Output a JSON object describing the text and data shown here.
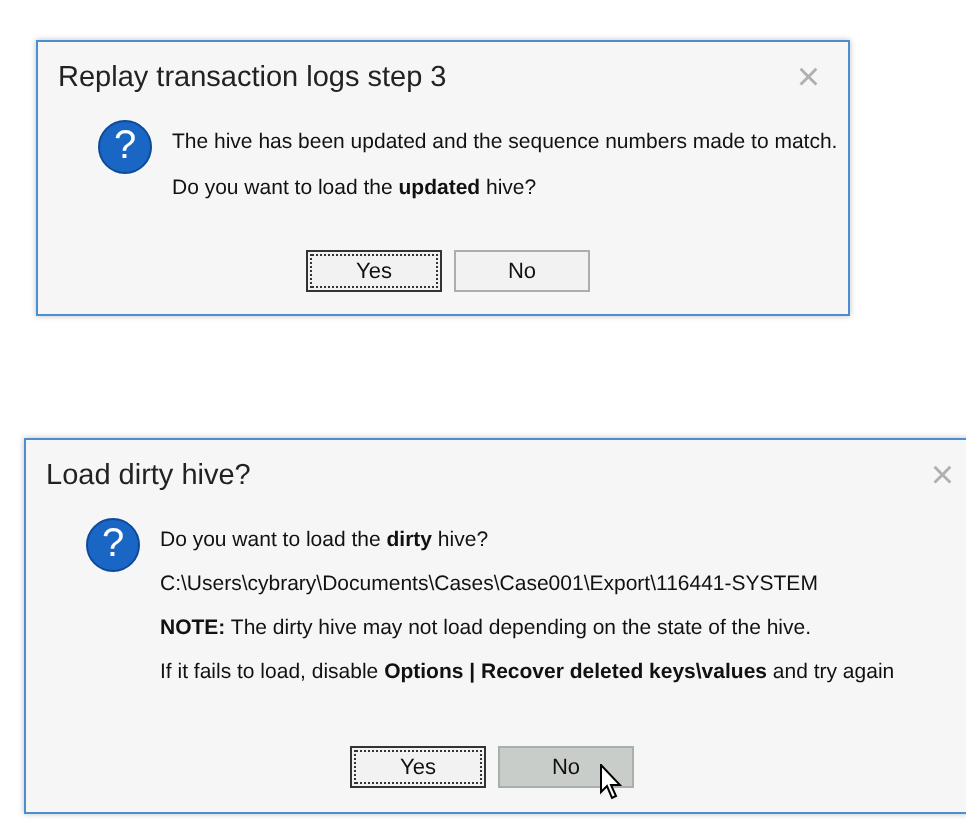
{
  "dialogs": [
    {
      "title": "Replay transaction logs step 3",
      "close": "×",
      "icon": "?",
      "messages": [
        "The hive has been updated and the sequence numbers made to match.",
        "Do you want to load the **updated** hive?"
      ],
      "buttons": [
        {
          "label": "Yes",
          "focused": true,
          "hovered": false
        },
        {
          "label": "No",
          "focused": false,
          "hovered": false
        }
      ],
      "cursor": false
    },
    {
      "title": "Load dirty hive?",
      "close": "×",
      "icon": "?",
      "messages": [
        "Do you want to load the **dirty** hive?",
        "C:\\Users\\cybrary\\Documents\\Cases\\Case001\\Export\\116441-SYSTEM",
        "**NOTE:** The dirty hive may not load depending on the state of the hive.",
        "If it fails to load, disable **Options | Recover deleted keys\\values** and try again"
      ],
      "buttons": [
        {
          "label": "Yes",
          "focused": true,
          "hovered": false
        },
        {
          "label": "No",
          "focused": false,
          "hovered": true
        }
      ],
      "cursor": true
    }
  ]
}
